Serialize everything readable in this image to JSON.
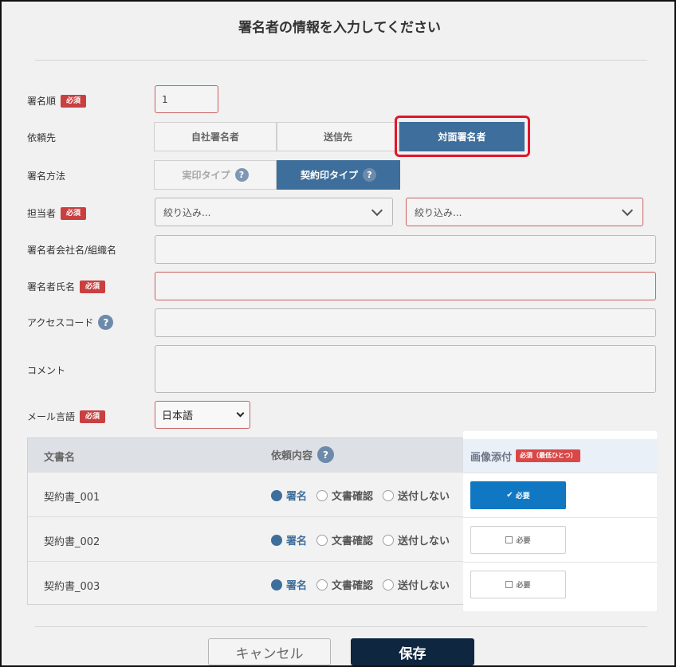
{
  "modal": {
    "title": "署名者の情報を入力してください"
  },
  "badges": {
    "required": "必須",
    "required_min_one": "必須（最低ひとつ）"
  },
  "help": {
    "glyph": "?"
  },
  "form": {
    "sign_order": {
      "label": "署名順",
      "value": "1"
    },
    "request_target": {
      "label": "依頼先",
      "options": [
        "自社署名者",
        "送信先",
        "対面署名者"
      ],
      "selected": "対面署名者"
    },
    "sign_method": {
      "label": "署名方法",
      "options": [
        "実印タイプ",
        "契約印タイプ"
      ],
      "selected": "契約印タイプ"
    },
    "assignee": {
      "label": "担当者",
      "filter1_placeholder": "絞り込み...",
      "filter2_placeholder": "絞り込み..."
    },
    "company": {
      "label": "署名者会社名/組織名",
      "value": ""
    },
    "signer_name": {
      "label": "署名者氏名",
      "value": ""
    },
    "access_code": {
      "label": "アクセスコード",
      "value": ""
    },
    "comment": {
      "label": "コメント",
      "value": ""
    },
    "mail_language": {
      "label": "メール言語",
      "value": "日本語"
    }
  },
  "table": {
    "headers": {
      "doc_name": "文書名",
      "request_content": "依頼内容",
      "image_attach": "画像添付"
    },
    "radio_labels": [
      "署名",
      "文書確認",
      "送付しない"
    ],
    "need_label": "必要",
    "rows": [
      {
        "doc": "契約書_001",
        "selected": "署名",
        "need": true
      },
      {
        "doc": "契約書_002",
        "selected": "署名",
        "need": false
      },
      {
        "doc": "契約書_003",
        "selected": "署名",
        "need": false
      }
    ]
  },
  "footer": {
    "cancel": "キャンセル",
    "save": "保存"
  },
  "colors": {
    "accent": "#3e6e9b",
    "required": "#c94040",
    "primary_dark": "#0f2640",
    "highlight": "#e2152a",
    "attach_active": "#1078c3"
  },
  "icons": {
    "check": "check-icon",
    "help": "help-circle-icon",
    "chevron": "chevron-down-icon"
  }
}
